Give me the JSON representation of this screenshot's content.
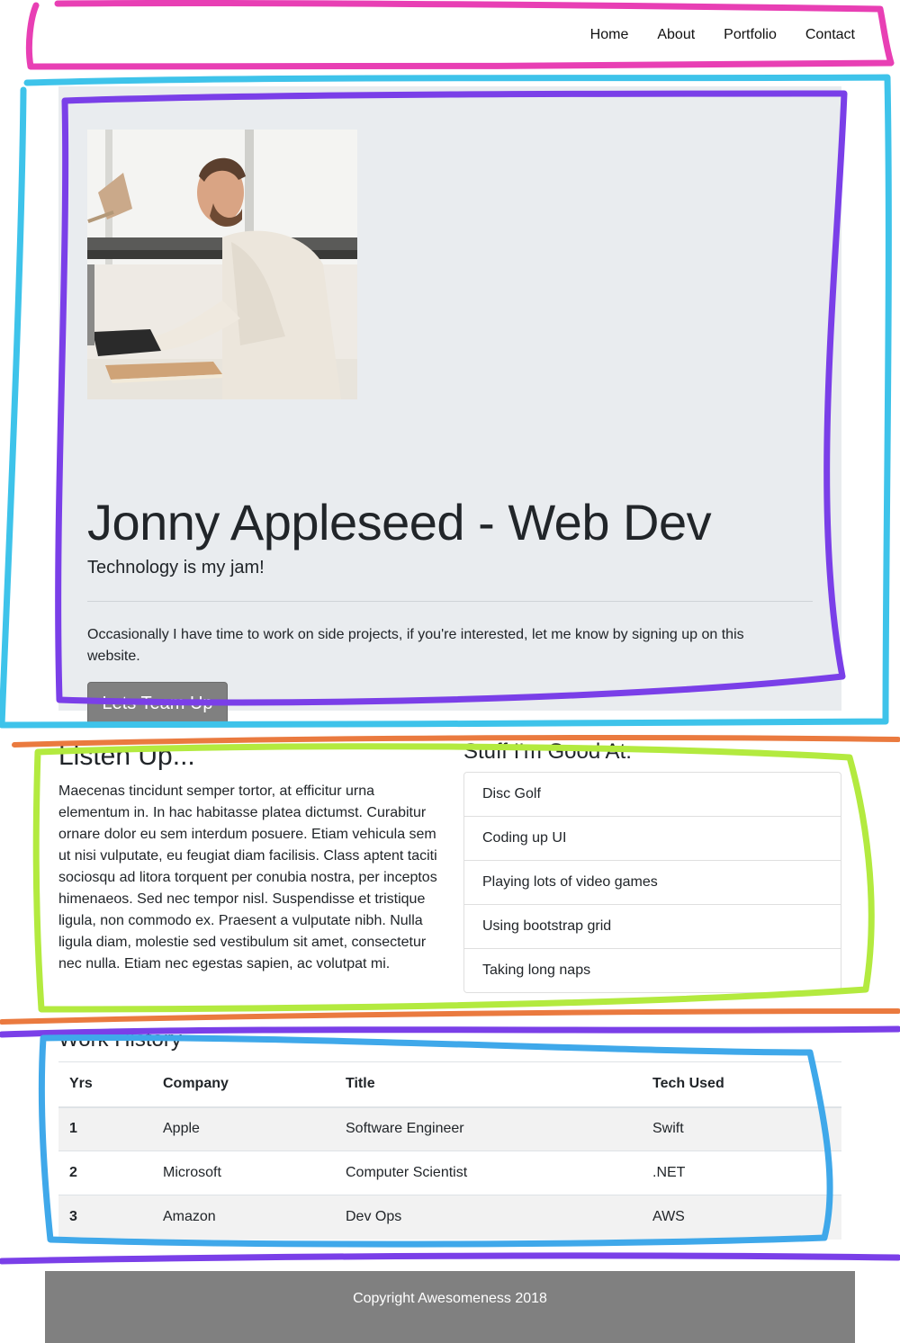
{
  "nav": {
    "items": [
      {
        "label": "Home"
      },
      {
        "label": "About"
      },
      {
        "label": "Portfolio"
      },
      {
        "label": "Contact"
      }
    ]
  },
  "hero": {
    "title": "Jonny Appleseed - Web Dev",
    "lead": "Technology is my jam!",
    "text": "Occasionally I have time to work on side projects, if you're interested, let me know by signing up on this website.",
    "button_label": "Lets Team Up"
  },
  "listen": {
    "title": "Listen Up...",
    "text": "Maecenas tincidunt semper tortor, at efficitur urna elementum in. In hac habitasse platea dictumst. Curabitur ornare dolor eu sem interdum posuere. Etiam vehicula sem ut nisi vulputate, eu feugiat diam facilisis. Class aptent taciti sociosqu ad litora torquent per conubia nostra, per inceptos himenaeos. Sed nec tempor nisl. Suspendisse et tristique ligula, non commodo ex. Praesent a vulputate nibh. Nulla ligula diam, molestie sed vestibulum sit amet, consectetur nec nulla. Etiam nec egestas sapien, ac volutpat mi."
  },
  "skills": {
    "title": "Stuff I'm Good At:",
    "items": [
      "Disc Golf",
      "Coding up UI",
      "Playing lots of video games",
      "Using bootstrap grid",
      "Taking long naps"
    ]
  },
  "work": {
    "title": "Work History",
    "headers": [
      "Yrs",
      "Company",
      "Title",
      "Tech Used"
    ],
    "rows": [
      [
        "1",
        "Apple",
        "Software Engineer",
        "Swift"
      ],
      [
        "2",
        "Microsoft",
        "Computer Scientist",
        ".NET"
      ],
      [
        "3",
        "Amazon",
        "Dev Ops",
        "AWS"
      ]
    ]
  },
  "footer": {
    "text": "Copyright Awesomeness 2018"
  },
  "colors": {
    "jumbotron_bg": "#e9ecef",
    "button_bg": "#808080",
    "footer_bg": "#808080",
    "annotation_pink": "#e83fb4",
    "annotation_cyan": "#3ec3ea",
    "annotation_purple": "#7a3fe8",
    "annotation_green": "#b3ea3f",
    "annotation_orange": "#ea7a3f",
    "annotation_blue": "#3fa8ea"
  }
}
